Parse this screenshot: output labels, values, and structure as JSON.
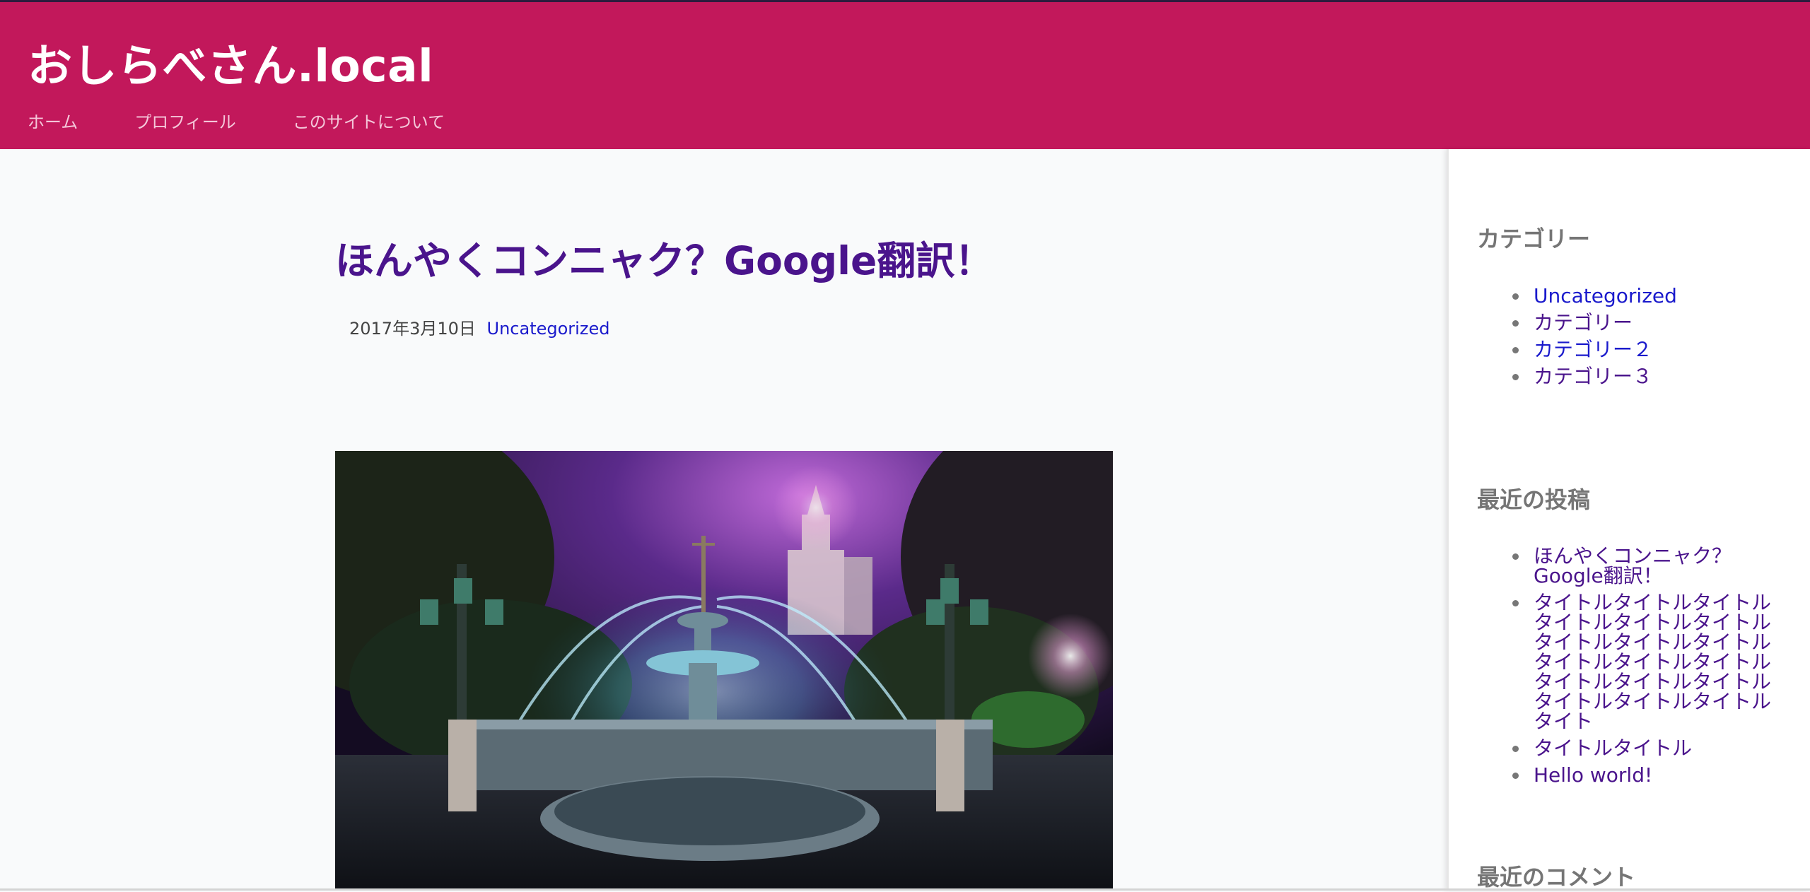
{
  "header": {
    "site_title": "おしらべさん.local",
    "nav": [
      {
        "label": "ホーム"
      },
      {
        "label": "プロフィール"
      },
      {
        "label": "このサイトについて"
      }
    ],
    "colors": {
      "background": "#c2185b",
      "title": "#ffffff",
      "nav": "#f4c6d9"
    }
  },
  "post": {
    "title": "ほんやくコンニャク？Google翻訳！",
    "date": "2017年3月10日",
    "category": "Uncategorized",
    "title_color": "#4a148c",
    "featured_image": {
      "subject": "night-fountain-photo"
    }
  },
  "sidebar": {
    "categories": {
      "title": "カテゴリー",
      "items": [
        {
          "label": "Uncategorized"
        },
        {
          "label": "カテゴリー"
        },
        {
          "label": "カテゴリー２"
        },
        {
          "label": "カテゴリー３"
        }
      ]
    },
    "recent_posts": {
      "title": "最近の投稿",
      "items": [
        {
          "label": "ほんやくコンニャク？Google翻訳！"
        },
        {
          "label": "タイトルタイトルタイトルタイトルタイトルタイトルタイトルタイトルタイトルタイトルタイトルタイトルタイトルタイトルタイトルタイトルタイトルタイトルタイト"
        },
        {
          "label": "タイトルタイトル"
        },
        {
          "label": "Hello world!"
        }
      ]
    },
    "recent_comments": {
      "title": "最近のコメント"
    }
  }
}
